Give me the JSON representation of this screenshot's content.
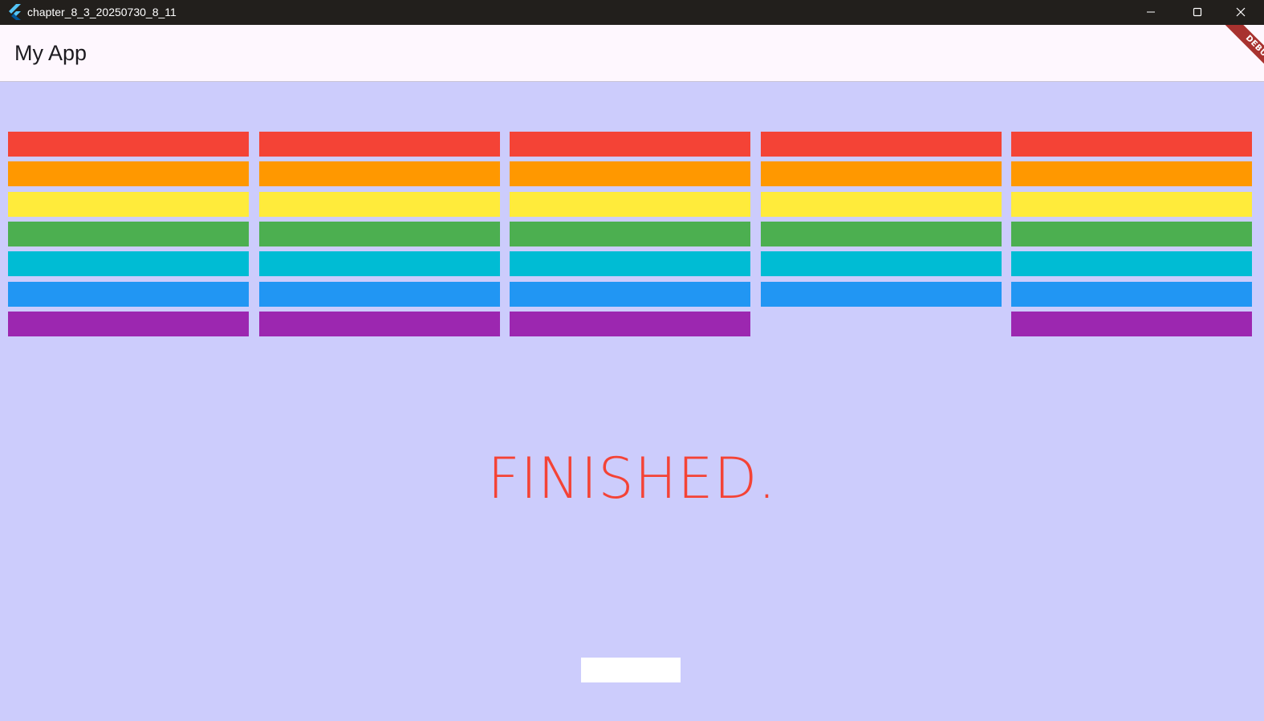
{
  "window": {
    "title": "chapter_8_3_20250730_8_11",
    "app_icon": "flutter-icon",
    "controls": [
      "minimize-icon",
      "maximize-icon",
      "close-icon"
    ]
  },
  "appbar": {
    "title": "My App",
    "debug_banner": "DEBUG"
  },
  "game": {
    "status_text": "FINISHED.",
    "background_color": "#ccccfc",
    "paddle_color": "#ffffff",
    "brick_colors": [
      "#f44336",
      "#ff9800",
      "#ffeb3b",
      "#4caf50",
      "#00bcd4",
      "#2196f3",
      "#9c27b0"
    ],
    "columns": 5,
    "missing_bricks": [
      {
        "column": 4,
        "row": 7
      }
    ]
  }
}
